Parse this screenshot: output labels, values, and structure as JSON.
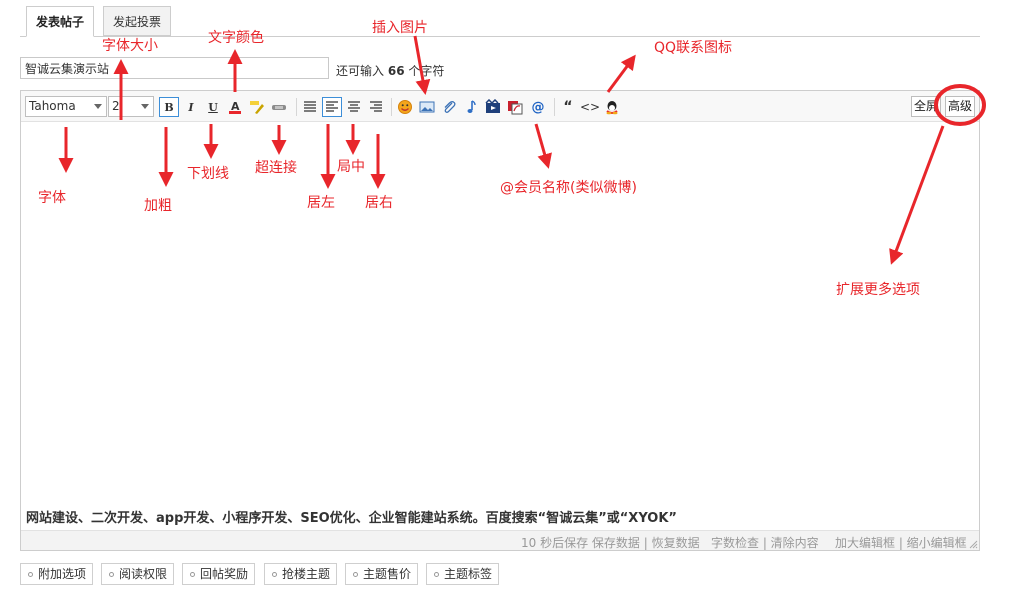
{
  "tabs": [
    {
      "label": "发表帖子"
    },
    {
      "label": "发起投票"
    }
  ],
  "subject": {
    "value": "智诚云集演示站",
    "counter_prefix": "还可输入",
    "counter_num": "66",
    "counter_suffix": "个字符"
  },
  "toolbar": {
    "font": "Tahoma",
    "size": "2",
    "bold": "B",
    "italic": "I",
    "underline": "U",
    "color": "A",
    "quote": "“",
    "code": "<>",
    "at": "@",
    "fullscreen": "全屏",
    "advanced": "高级"
  },
  "editor": {
    "content": "网站建设、二次开发、app开发、小程序开发、SEO优化、企业智能建站系统。百度搜索“智诚云集”或“XYOK”"
  },
  "statusbar": {
    "left": "10 秒后保存 保存数据 | 恢复数据",
    "mid": "字数检查 | 清除内容",
    "right": "加大编辑框 | 缩小编辑框"
  },
  "options": [
    "附加选项",
    "阅读权限",
    "回帖奖励",
    "抢楼主题",
    "主题售价",
    "主题标签"
  ],
  "annotations": {
    "font_size": "字体大小",
    "text_color": "文字颜色",
    "insert_image": "插入图片",
    "qq_icon": "QQ联系图标",
    "font": "字体",
    "bold": "加粗",
    "underline": "下划线",
    "hyperlink": "超连接",
    "align_left": "居左",
    "align_center": "局中",
    "align_right": "居右",
    "at_member": "@会员名称(类似微博)",
    "more_options": "扩展更多选项"
  },
  "colors": {
    "annotation": "#e8262b",
    "accent": "#3c8ed8"
  }
}
